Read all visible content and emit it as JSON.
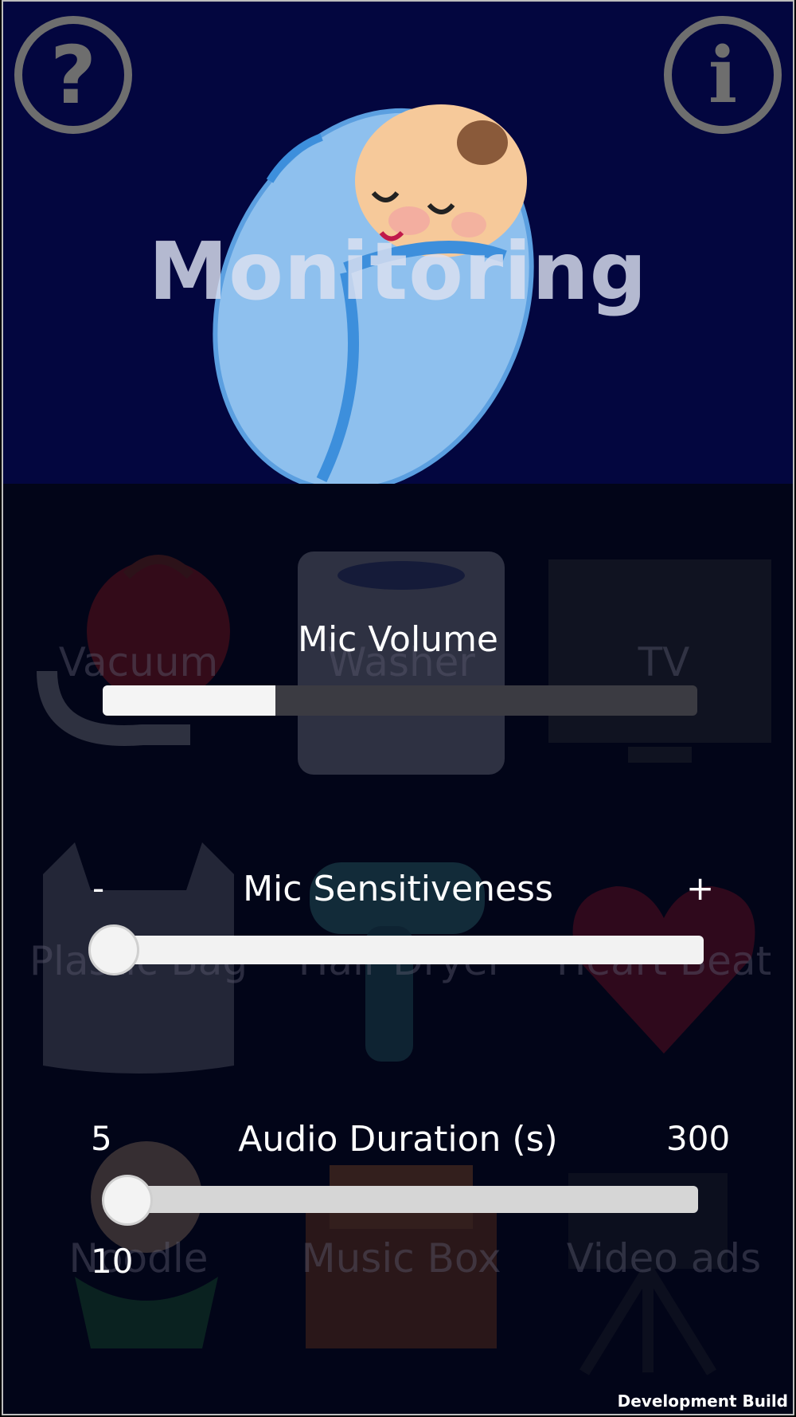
{
  "header": {
    "title": "Monitoring",
    "help_glyph": "?",
    "info_glyph": "i"
  },
  "sound_options": [
    {
      "label": "Vacuum",
      "icon": "vacuum-icon"
    },
    {
      "label": "Washer",
      "icon": "washer-icon"
    },
    {
      "label": "TV",
      "icon": "tv-icon"
    },
    {
      "label": "Plastic Bag",
      "icon": "plastic-bag-icon"
    },
    {
      "label": "Hair Dryer",
      "icon": "hair-dryer-icon"
    },
    {
      "label": "Heart Beat",
      "icon": "heart-icon"
    },
    {
      "label": "Noodle",
      "icon": "noodle-icon"
    },
    {
      "label": "Music Box",
      "icon": "music-box-icon"
    },
    {
      "label": "Video ads",
      "icon": "video-camera-icon"
    }
  ],
  "mic_volume": {
    "title": "Mic Volume",
    "level": 0.29
  },
  "mic_sensitiveness": {
    "title": "Mic Sensitiveness",
    "min_label": "-",
    "max_label": "+",
    "level": 0.0
  },
  "audio_duration": {
    "title": "Audio Duration (s)",
    "min_label": "5",
    "max_label": "300",
    "value_label": "10",
    "min": 5,
    "max": 300,
    "value": 10
  },
  "footer": {
    "build_label": "Development Build"
  },
  "colors": {
    "header_bg": "#03063f",
    "body_bg": "#020518",
    "blanket": "#7db3e8",
    "title_text": "#dce1f0"
  }
}
